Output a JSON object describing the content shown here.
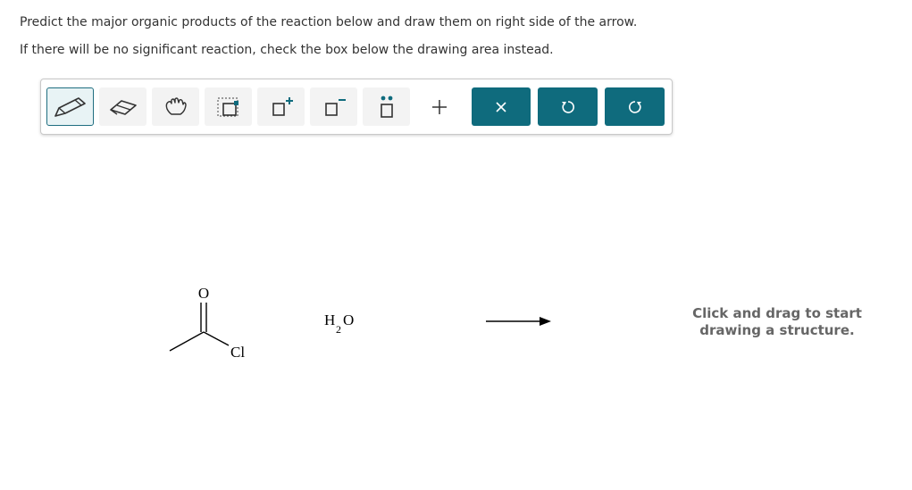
{
  "question": {
    "line1": "Predict the major organic products of the reaction below and draw them on right side of the arrow.",
    "line2": "If there will be no significant reaction, check the box below the drawing area instead."
  },
  "toolbar": {
    "tools": [
      {
        "name": "pencil-tool",
        "icon": "pencil-icon",
        "active": true
      },
      {
        "name": "eraser-tool",
        "icon": "eraser-icon"
      },
      {
        "name": "hand-tool",
        "icon": "hand-icon"
      },
      {
        "name": "select-tool",
        "icon": "selection-icon"
      },
      {
        "name": "positive-charge-tool",
        "icon": "positive-charge-icon",
        "label": "+"
      },
      {
        "name": "negative-charge-tool",
        "icon": "negative-charge-icon",
        "label": "−"
      },
      {
        "name": "lone-pair-tool",
        "icon": "lone-pair-icon"
      },
      {
        "name": "add-tool",
        "icon": "plus-icon",
        "label": "+"
      },
      {
        "name": "clear-button",
        "icon": "close-icon",
        "label": "×"
      },
      {
        "name": "undo-button",
        "icon": "undo-icon"
      },
      {
        "name": "redo-button",
        "icon": "redo-icon"
      }
    ],
    "colors": {
      "accent": "#0f6b7d",
      "active_bg": "#e8f3f5",
      "button_bg": "#f3f3f3"
    }
  },
  "reaction": {
    "reactant_atoms": {
      "oxygen": "O",
      "chlorine": "Cl"
    },
    "reagent": {
      "h": "H",
      "subscript": "2",
      "o": "O"
    }
  },
  "drawing_hint": {
    "line1": "Click and drag to start",
    "line2": "drawing a structure."
  }
}
